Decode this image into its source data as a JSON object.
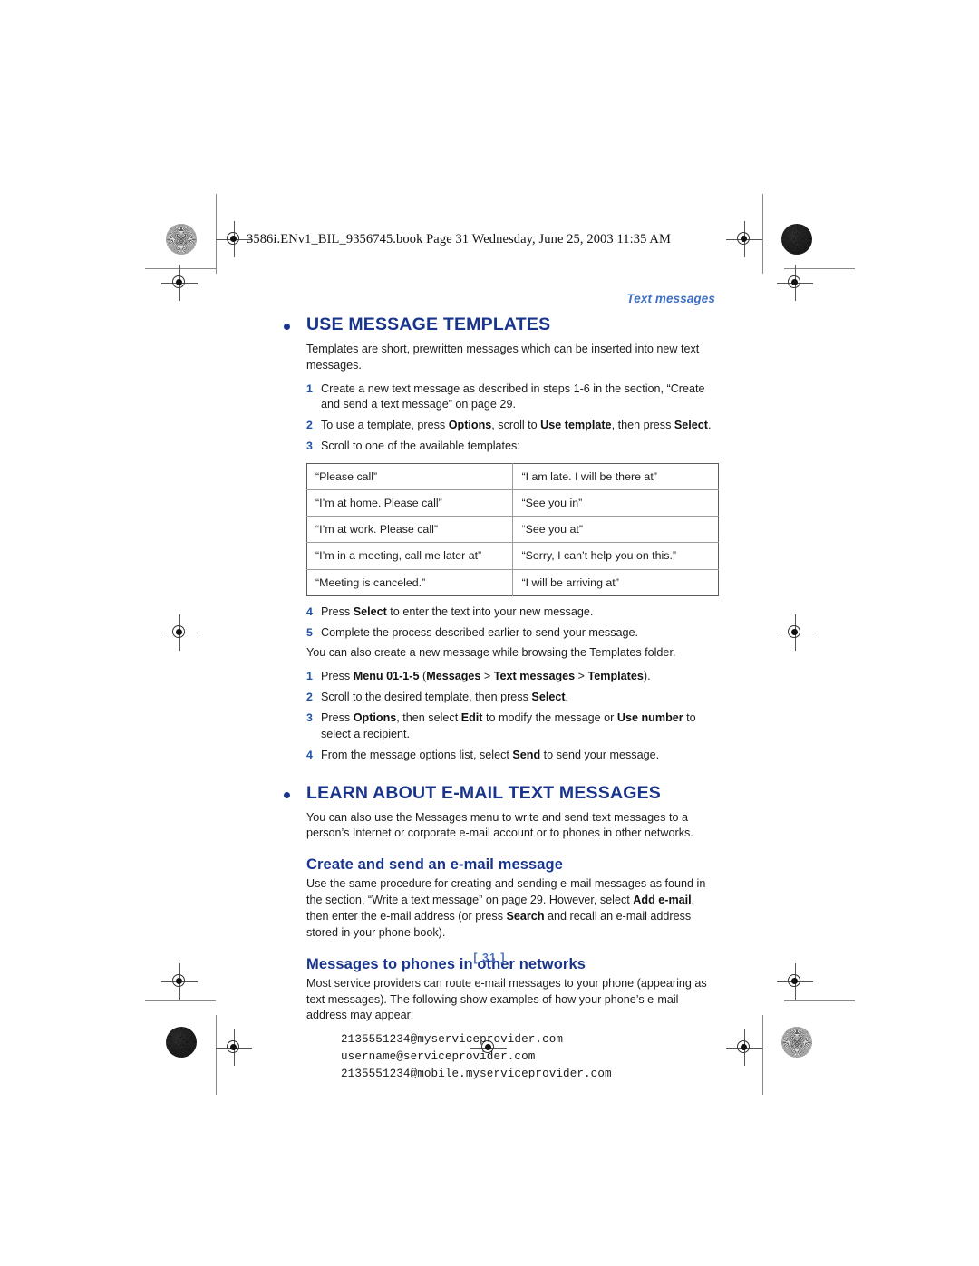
{
  "file_header": "3586i.ENv1_BIL_9356745.book  Page 31  Wednesday, June 25, 2003  11:35 AM",
  "running_head": "Text messages",
  "page_number": "[ 31 ]",
  "colors": {
    "heading_blue": "#18348c",
    "step_number_blue": "#1f52a8",
    "running_head_blue": "#3f6fc4",
    "page_number_blue": "#4a72c0",
    "body_text": "#1c1c1c",
    "table_outer_border": "#5c5c5c",
    "table_inner_border": "#9b9b9b"
  },
  "sections": {
    "templates": {
      "title": "USE MESSAGE TEMPLATES",
      "intro": "Templates are short, prewritten messages which can be inserted into new text messages.",
      "steps_a": [
        {
          "num": "1",
          "html": "Create a new text message as described in steps 1-6 in the section, “Create and send a text message” on page 29."
        },
        {
          "num": "2",
          "html": "To use a template, press <b>Options</b>, scroll to <b>Use template</b>, then press <b>Select</b>."
        },
        {
          "num": "3",
          "html": "Scroll to one of the available templates:"
        }
      ],
      "table": {
        "rows": [
          [
            "“Please call”",
            "“I am late. I will be there at”"
          ],
          [
            "“I’m at home. Please call”",
            "“See you in”"
          ],
          [
            "“I’m at work. Please call”",
            "“See you at”"
          ],
          [
            "“I’m in a meeting, call me later at”",
            "“Sorry, I can’t help you on this.”"
          ],
          [
            "“Meeting is canceled.”",
            "“I will be arriving at”"
          ]
        ]
      },
      "steps_b": [
        {
          "num": "4",
          "html": "Press <b>Select</b> to enter the text into your new message."
        },
        {
          "num": "5",
          "html": "Complete the process described earlier to send your message."
        }
      ],
      "note": "You can also create a new message while browsing the Templates folder.",
      "steps_c": [
        {
          "num": "1",
          "html": "Press <b>Menu 01-1-5</b> (<b>Messages</b> &gt; <b>Text messages</b> &gt; <b>Templates</b>)."
        },
        {
          "num": "2",
          "html": "Scroll to the desired template, then press <b>Select</b>."
        },
        {
          "num": "3",
          "html": "Press <b>Options</b>, then select <b>Edit</b> to modify the message or <b>Use number</b> to select a recipient."
        },
        {
          "num": "4",
          "html": "From the message options list, select <b>Send</b> to send your message."
        }
      ]
    },
    "email": {
      "title": "LEARN ABOUT E-MAIL TEXT MESSAGES",
      "intro": "You can also use the Messages menu to write and send text messages to a person’s Internet or corporate e-mail account or to phones in other networks.",
      "sub1": {
        "title": "Create and send an e-mail message",
        "body_html": "Use the same procedure for creating and sending e-mail messages as found in the section, “Write a text message” on page 29. However, select <b>Add e-mail</b>, then enter the e-mail address (or press <b>Search</b> and recall an e-mail address stored in your phone book)."
      },
      "sub2": {
        "title": "Messages to phones in other networks",
        "body_html": "Most service providers can route e-mail messages to your phone (appearing as text messages). The following show examples of how your phone’s e-mail address may appear:",
        "examples": [
          "2135551234@myserviceprovider.com",
          "username@serviceprovider.com",
          "2135551234@mobile.myserviceprovider.com"
        ]
      }
    }
  }
}
